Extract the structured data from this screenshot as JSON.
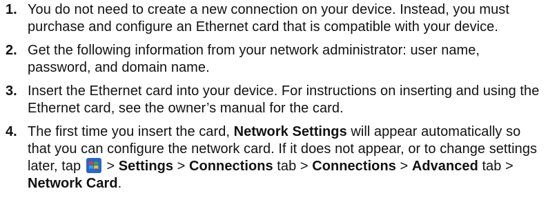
{
  "steps": [
    {
      "number": "1.",
      "text": "You do not need to create a new connection on your device. Instead, you must purchase and configure an Ethernet card that is compatible with your device."
    },
    {
      "number": "2.",
      "text": "Get the following information from your network administrator: user name, password, and domain name."
    },
    {
      "number": "3.",
      "text": "Insert the Ethernet card into your device. For instructions on inserting and using the Ethernet card, see the owner’s manual for the card."
    },
    {
      "number": "4.",
      "parts": {
        "t1": "The first time you insert the card, ",
        "b1": "Network Settings",
        "t2": " will appear automatically so that you can configure the network card. If it does not appear, or to change settings later, tap ",
        "start_icon": "windows-start-icon",
        "t3": " > ",
        "b2": "Settings",
        "t4": " > ",
        "b3": "Connections",
        "t5": " tab > ",
        "b4": "Connections",
        "t6": " > ",
        "b5": "Advanced",
        "t7": " tab > ",
        "b6": "Network Card",
        "t8": "."
      }
    }
  ],
  "colors": {
    "text": "#111111",
    "icon_blue": "#2a66c9",
    "icon_red": "#e0402a",
    "icon_green": "#3aa83a",
    "icon_yellow": "#f2c01e"
  }
}
